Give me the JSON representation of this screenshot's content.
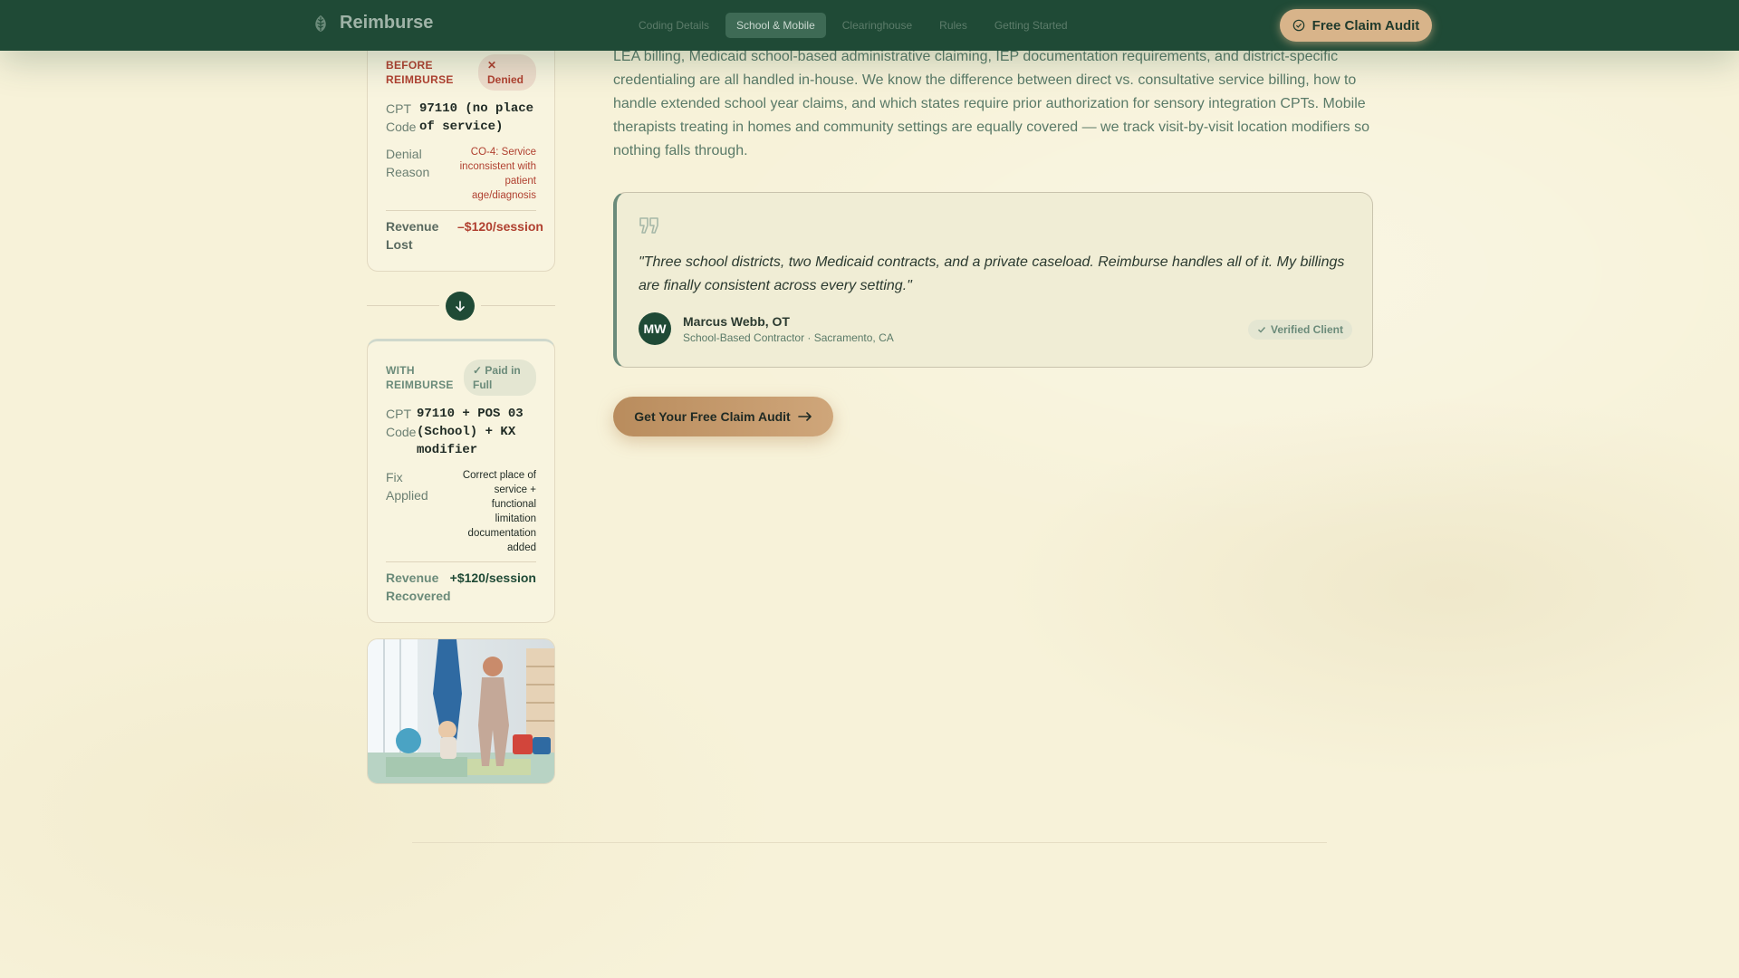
{
  "header": {
    "brand": "Reimburse",
    "nav": [
      "Coding Details",
      "School & Mobile",
      "Clearinghouse",
      "Rules",
      "Getting Started"
    ],
    "active_nav": "School & Mobile",
    "cta": "Free Claim Audit"
  },
  "before_card": {
    "title": "BEFORE REIMBURSE",
    "badge": "✕ Denied",
    "cpt_label": "CPT Code",
    "cpt_value": "97110 (no place of service)",
    "denial_label": "Denial Reason",
    "denial_value": "CO-4: Service inconsistent with patient age/diagnosis",
    "revenue_label": "Revenue Lost",
    "revenue_value": "–$120/session"
  },
  "with_card": {
    "title": "WITH REIMBURSE",
    "badge": "✓ Paid in Full",
    "cpt_label": "CPT Code",
    "cpt_value": "97110 + POS 03 (School) + KX modifier",
    "fix_label": "Fix Applied",
    "fix_value": "Correct place of service + functional limitation documentation added",
    "revenue_label": "Revenue Recovered",
    "revenue_value": "+$120/session"
  },
  "main": {
    "paragraph": "LEA billing, Medicaid school-based administrative claiming, IEP documentation requirements, and district-specific credentialing are all handled in-house. We know the difference between direct vs. consultative service billing, how to handle extended school year claims, and which states require prior authorization for sensory integration CPTs. Mobile therapists treating in homes and community settings are equally covered — we track visit-by-visit location modifiers so nothing falls through.",
    "quote": "\"Three school districts, two Medicaid contracts, and a private caseload. Reimburse handles all of it. My billings are finally consistent across every setting.\"",
    "avatar_initials": "MW",
    "author_name": "Marcus Webb, OT",
    "author_role": "School-Based Contractor · Sacramento, CA",
    "verified": "Verified Client",
    "cta": "Get Your Free Claim Audit"
  },
  "colors": {
    "header_bg": "#1f4a36",
    "page_bg": "#f7f2d9",
    "accent_tan": "#d8b48a",
    "denied_red": "#b04030"
  }
}
